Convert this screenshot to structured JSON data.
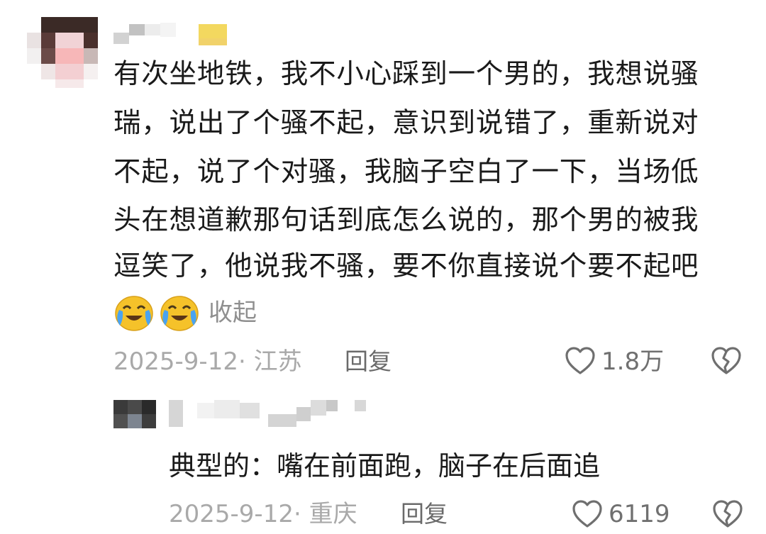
{
  "comment": {
    "lines": [
      "有次坐地铁，我不小心踩到一个男的，我想说骚",
      "瑞，说出了个骚不起，意识到说错了，重新说对",
      "不起，说了个对骚，我脑子空白了一下，当场低",
      "头在想道歉那句话到底怎么说的，那个男的被我",
      "逗笑了，他说我不骚，要不你直接说个要不起吧"
    ],
    "emoji_icon": "crying-laughing-emoji",
    "collapse_label": "收起",
    "date": "2025-9-12",
    "location": "江苏",
    "reply_label": "回复",
    "like_count": "1.8万"
  },
  "reply": {
    "text": "典型的：嘴在前面跑，脑子在后面追",
    "date": "2025-9-12",
    "location": "重庆",
    "reply_label": "回复",
    "like_count": "6119"
  },
  "colors": {
    "text": "#1a1a1a",
    "meta": "#a9a9a9",
    "icon": "#6f6f6f",
    "emoji": "#f5c22a"
  }
}
